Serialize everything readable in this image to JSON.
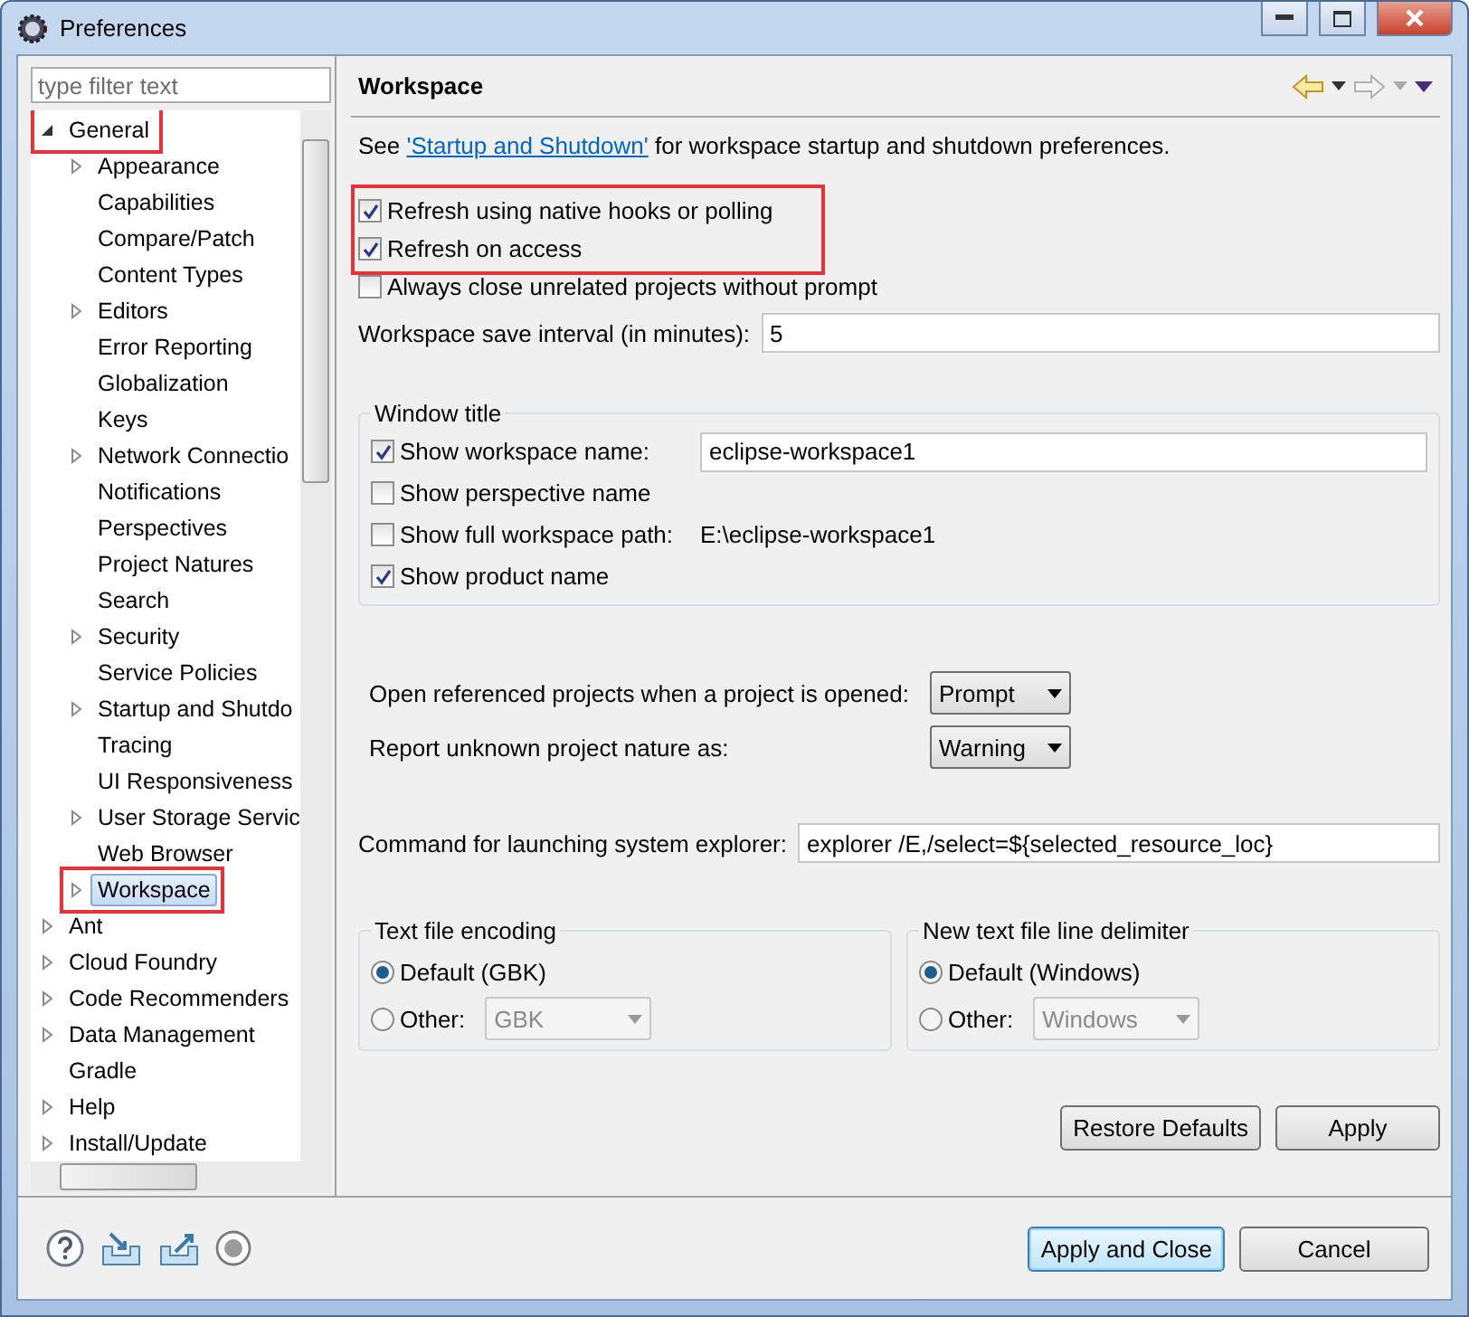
{
  "window": {
    "title": "Preferences"
  },
  "filter": {
    "placeholder": "type filter text"
  },
  "tree": [
    {
      "label": "General",
      "expandable": true,
      "expanded": true,
      "selected": false,
      "highlighted": true,
      "children": [
        {
          "label": "Appearance",
          "expandable": true,
          "expanded": false,
          "selected": false,
          "highlighted": false
        },
        {
          "label": "Capabilities",
          "expandable": false,
          "selected": false,
          "highlighted": false
        },
        {
          "label": "Compare/Patch",
          "expandable": false,
          "selected": false,
          "highlighted": false
        },
        {
          "label": "Content Types",
          "expandable": false,
          "selected": false,
          "highlighted": false
        },
        {
          "label": "Editors",
          "expandable": true,
          "expanded": false,
          "selected": false,
          "highlighted": false
        },
        {
          "label": "Error Reporting",
          "expandable": false,
          "selected": false,
          "highlighted": false
        },
        {
          "label": "Globalization",
          "expandable": false,
          "selected": false,
          "highlighted": false
        },
        {
          "label": "Keys",
          "expandable": false,
          "selected": false,
          "highlighted": false
        },
        {
          "label": "Network Connectio",
          "expandable": true,
          "expanded": false,
          "selected": false,
          "highlighted": false
        },
        {
          "label": "Notifications",
          "expandable": false,
          "selected": false,
          "highlighted": false
        },
        {
          "label": "Perspectives",
          "expandable": false,
          "selected": false,
          "highlighted": false
        },
        {
          "label": "Project Natures",
          "expandable": false,
          "selected": false,
          "highlighted": false
        },
        {
          "label": "Search",
          "expandable": false,
          "selected": false,
          "highlighted": false
        },
        {
          "label": "Security",
          "expandable": true,
          "expanded": false,
          "selected": false,
          "highlighted": false
        },
        {
          "label": "Service Policies",
          "expandable": false,
          "selected": false,
          "highlighted": false
        },
        {
          "label": "Startup and Shutdo",
          "expandable": true,
          "expanded": false,
          "selected": false,
          "highlighted": false
        },
        {
          "label": "Tracing",
          "expandable": false,
          "selected": false,
          "highlighted": false
        },
        {
          "label": "UI Responsiveness",
          "expandable": false,
          "selected": false,
          "highlighted": false
        },
        {
          "label": "User Storage Servic",
          "expandable": true,
          "expanded": false,
          "selected": false,
          "highlighted": false
        },
        {
          "label": "Web Browser",
          "expandable": false,
          "selected": false,
          "highlighted": false
        },
        {
          "label": "Workspace",
          "expandable": true,
          "expanded": false,
          "selected": true,
          "highlighted": true
        }
      ]
    },
    {
      "label": "Ant",
      "expandable": true,
      "expanded": false,
      "selected": false,
      "highlighted": false
    },
    {
      "label": "Cloud Foundry",
      "expandable": true,
      "expanded": false,
      "selected": false,
      "highlighted": false
    },
    {
      "label": "Code Recommenders",
      "expandable": true,
      "expanded": false,
      "selected": false,
      "highlighted": false
    },
    {
      "label": "Data Management",
      "expandable": true,
      "expanded": false,
      "selected": false,
      "highlighted": false
    },
    {
      "label": "Gradle",
      "expandable": false,
      "selected": false,
      "highlighted": false
    },
    {
      "label": "Help",
      "expandable": true,
      "expanded": false,
      "selected": false,
      "highlighted": false
    },
    {
      "label": "Install/Update",
      "expandable": true,
      "expanded": false,
      "selected": false,
      "highlighted": false
    }
  ],
  "page": {
    "title": "Workspace",
    "intro": {
      "before": "See ",
      "link": "'Startup and Shutdown'",
      "after": " for workspace startup and shutdown preferences."
    },
    "checkbox_groups": [
      {
        "highlighted": true,
        "items": [
          {
            "label": "Refresh using native hooks or polling",
            "checked": true
          },
          {
            "label": "Refresh on access",
            "checked": true
          }
        ]
      },
      {
        "highlighted": false,
        "items": [
          {
            "label": "Always close unrelated projects without prompt",
            "checked": false
          }
        ]
      }
    ],
    "save_interval": {
      "label": "Workspace save interval (in minutes):",
      "value": "5"
    },
    "window_title": {
      "legend": "Window title",
      "options": [
        {
          "kind": "input",
          "label": "Show workspace name:",
          "checked": true,
          "value": "eclipse-workspace1"
        },
        {
          "kind": "plain",
          "label": "Show perspective name",
          "checked": false
        },
        {
          "kind": "path",
          "label": "Show full workspace path:",
          "checked": false,
          "value": "E:\\eclipse-workspace1"
        },
        {
          "kind": "plain",
          "label": "Show product name",
          "checked": true
        }
      ]
    },
    "selects": [
      {
        "label": "Open referenced projects when a project is opened:",
        "value": "Prompt"
      },
      {
        "label": "Report unknown project nature as:",
        "value": "Warning"
      }
    ],
    "explorer": {
      "label": "Command for launching system explorer:",
      "value": "explorer /E,/select=${selected_resource_loc}"
    },
    "radio_groups": [
      {
        "legend": "Text file encoding",
        "options": [
          {
            "label": "Default (GBK)",
            "selected": true
          },
          {
            "label": "Other:",
            "selected": false,
            "combo": {
              "value": "GBK",
              "disabled": true
            }
          }
        ]
      },
      {
        "legend": "New text file line delimiter",
        "options": [
          {
            "label": "Default (Windows)",
            "selected": true
          },
          {
            "label": "Other:",
            "selected": false,
            "combo": {
              "value": "Windows",
              "disabled": true
            }
          }
        ]
      }
    ],
    "page_buttons": [
      "Restore Defaults",
      "Apply"
    ]
  },
  "dialog_buttons": [
    {
      "label": "Apply and Close",
      "default": true
    },
    {
      "label": "Cancel",
      "default": false
    }
  ]
}
